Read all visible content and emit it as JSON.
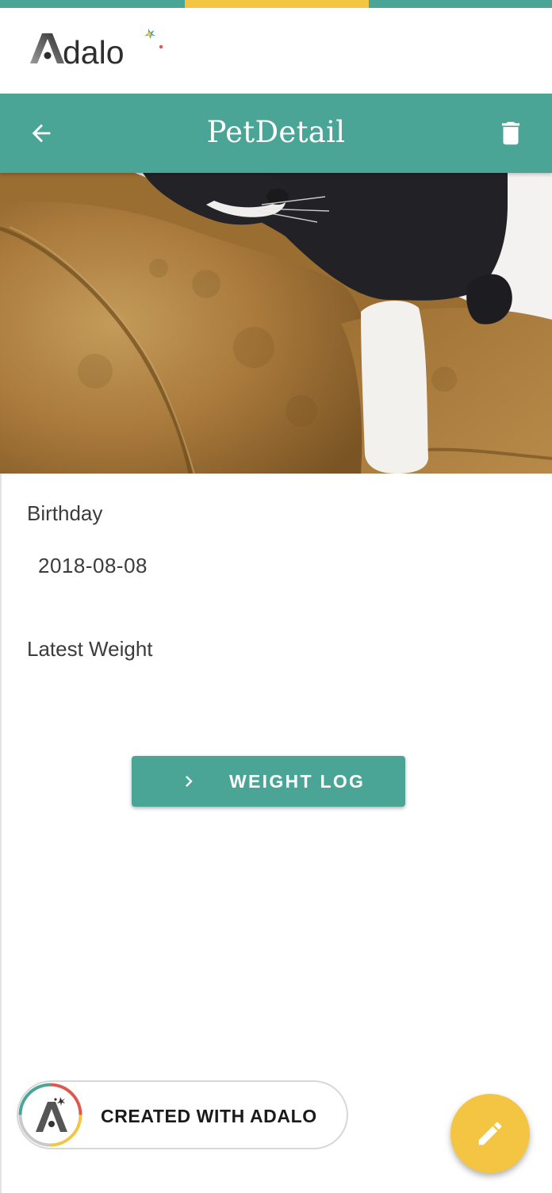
{
  "brand": {
    "logo_text": "Adalo",
    "colors": {
      "teal": "#4ba597",
      "yellow": "#f4c543",
      "gray": "#8a8a8a"
    }
  },
  "app_bar": {
    "title": "PetDetail",
    "back_icon": "arrow-left-icon",
    "delete_icon": "trash-icon"
  },
  "pet": {
    "photo_icon": "pet-photo-cat-on-sofa"
  },
  "details": {
    "birthday_label": "Birthday",
    "birthday_value": "2018-08-08",
    "weight_label": "Latest Weight"
  },
  "weight_log_button": {
    "label": "WEIGHT LOG",
    "icon": "chevron-right-icon"
  },
  "badge": {
    "text": "CREATED WITH ADALO",
    "icon": "adalo-icon"
  },
  "fab": {
    "icon": "pencil-icon",
    "color": "#f4c543"
  }
}
